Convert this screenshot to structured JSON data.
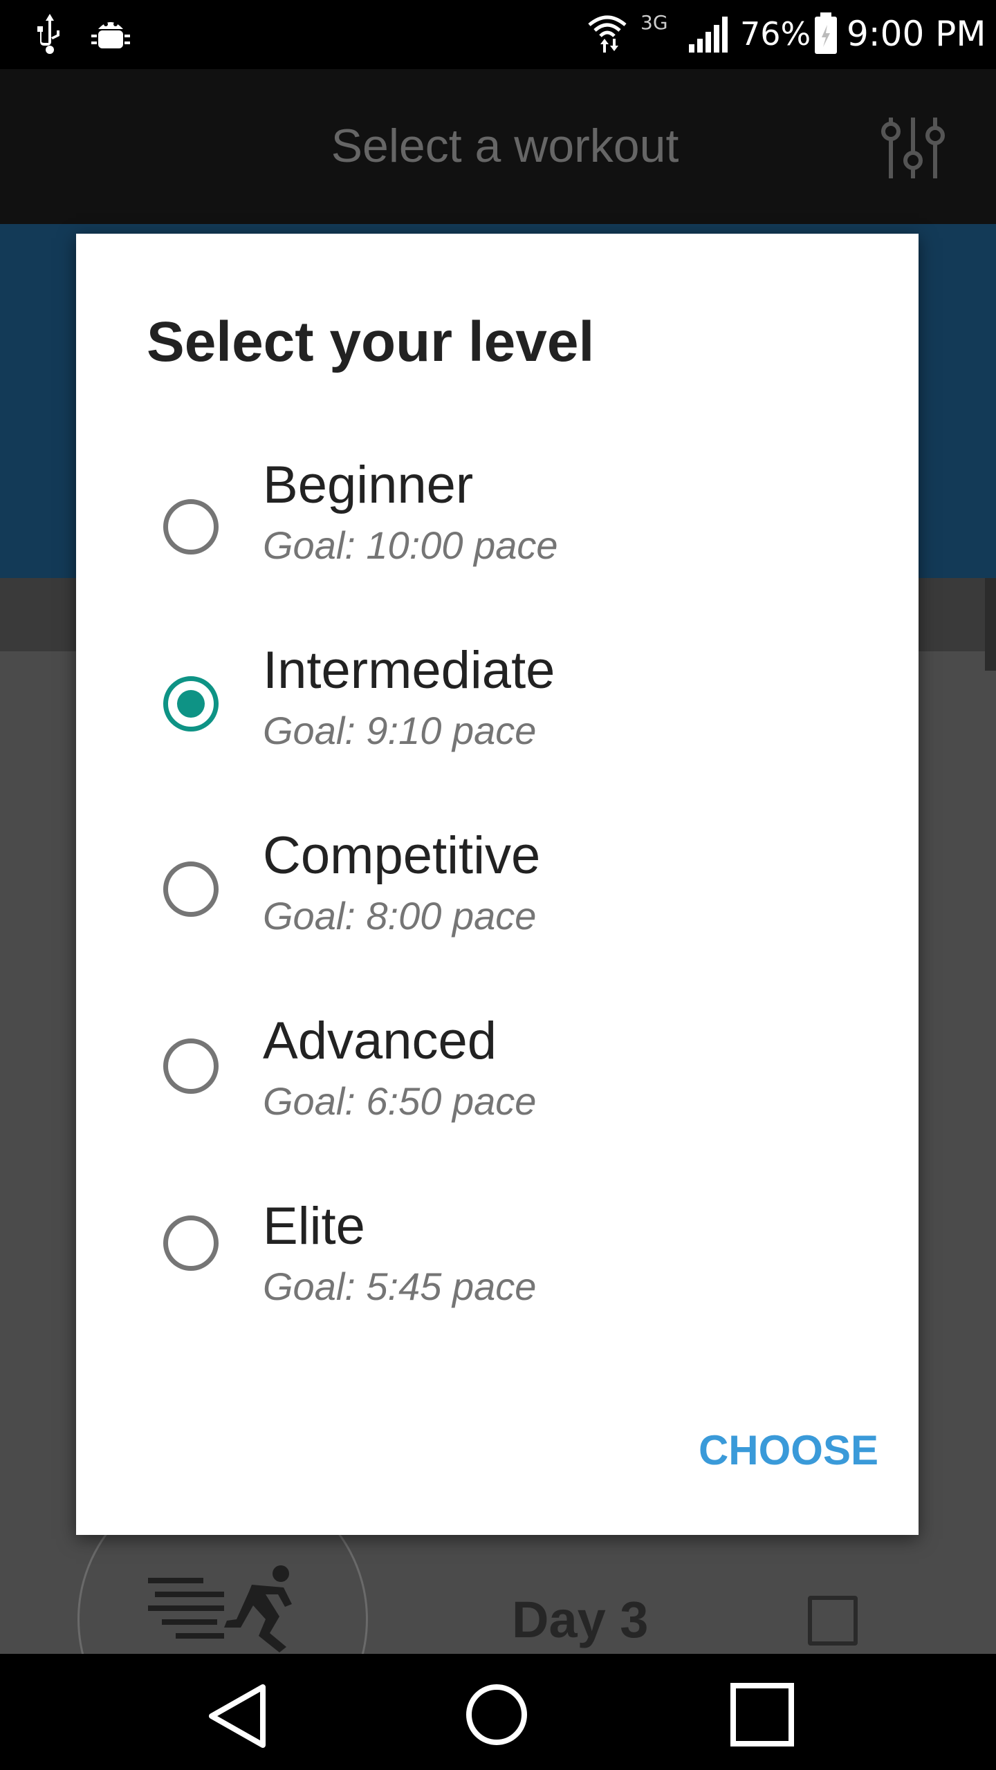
{
  "status_bar": {
    "network_type": "3G",
    "battery_percent": "76%",
    "time": "9:00 PM"
  },
  "background": {
    "title": "Select a workout",
    "day_label": "Day 3"
  },
  "dialog": {
    "title": "Select your level",
    "levels": [
      {
        "name": "Beginner",
        "goal": "Goal: 10:00 pace",
        "selected": false
      },
      {
        "name": "Intermediate",
        "goal": "Goal: 9:10 pace",
        "selected": true
      },
      {
        "name": "Competitive",
        "goal": "Goal: 8:00 pace",
        "selected": false
      },
      {
        "name": "Advanced",
        "goal": "Goal: 6:50 pace",
        "selected": false
      },
      {
        "name": "Elite",
        "goal": "Goal: 5:45 pace",
        "selected": false
      }
    ],
    "choose_label": "CHOOSE"
  },
  "colors": {
    "accent_teal": "#0e9385",
    "action_blue": "#3a9ad9"
  }
}
